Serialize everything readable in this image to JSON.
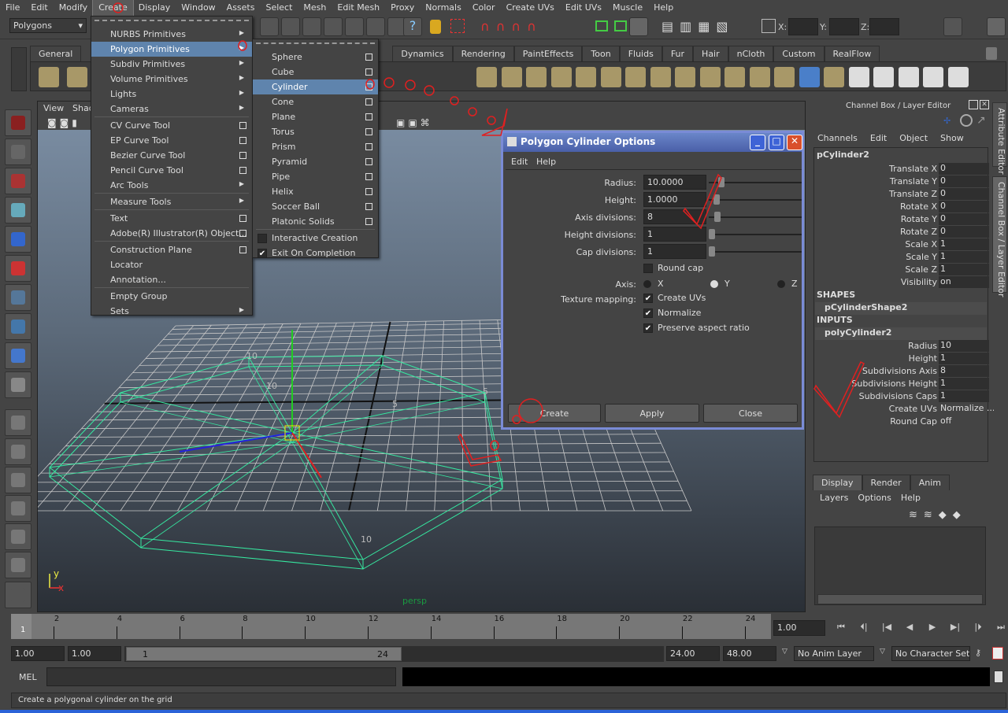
{
  "menubar": [
    "File",
    "Edit",
    "Modify",
    "Create",
    "Display",
    "Window",
    "Assets",
    "Select",
    "Mesh",
    "Edit Mesh",
    "Proxy",
    "Normals",
    "Color",
    "Create UVs",
    "Edit UVs",
    "Muscle",
    "Help"
  ],
  "status_line": {
    "menu_set": "Polygons",
    "x_label": "X:",
    "y_label": "Y:",
    "z_label": "Z:"
  },
  "shelf_tabs": [
    "General",
    "Dynamics",
    "Rendering",
    "PaintEffects",
    "Toon",
    "Fluids",
    "Fur",
    "Hair",
    "nCloth",
    "Custom",
    "RealFlow"
  ],
  "create_menu": [
    {
      "label": "NURBS Primitives",
      "type": "sub"
    },
    {
      "label": "Polygon Primitives",
      "type": "sub",
      "hl": true
    },
    {
      "label": "Subdiv Primitives",
      "type": "sub"
    },
    {
      "label": "Volume Primitives",
      "type": "sub"
    },
    {
      "label": "Lights",
      "type": "sub"
    },
    {
      "label": "Cameras",
      "type": "sub"
    },
    {
      "type": "sep"
    },
    {
      "label": "CV Curve Tool",
      "type": "opt"
    },
    {
      "label": "EP Curve Tool",
      "type": "opt"
    },
    {
      "label": "Bezier Curve Tool",
      "type": "opt"
    },
    {
      "label": "Pencil Curve Tool",
      "type": "opt"
    },
    {
      "label": "Arc Tools",
      "type": "sub"
    },
    {
      "type": "sep"
    },
    {
      "label": "Measure Tools",
      "type": "sub"
    },
    {
      "type": "sep"
    },
    {
      "label": "Text",
      "type": "opt"
    },
    {
      "label": "Adobe(R) Illustrator(R) Object...",
      "type": "opt"
    },
    {
      "type": "sep"
    },
    {
      "label": "Construction Plane",
      "type": "opt"
    },
    {
      "label": "Locator",
      "type": "none"
    },
    {
      "label": "Annotation...",
      "type": "none"
    },
    {
      "type": "sep"
    },
    {
      "label": "Empty Group",
      "type": "none"
    },
    {
      "label": "Sets",
      "type": "sub"
    }
  ],
  "poly_menu": [
    {
      "label": "Sphere",
      "type": "opt"
    },
    {
      "label": "Cube",
      "type": "opt"
    },
    {
      "label": "Cylinder",
      "type": "opt",
      "hl": true
    },
    {
      "label": "Cone",
      "type": "opt"
    },
    {
      "label": "Plane",
      "type": "opt"
    },
    {
      "label": "Torus",
      "type": "opt"
    },
    {
      "label": "Prism",
      "type": "opt"
    },
    {
      "label": "Pyramid",
      "type": "opt"
    },
    {
      "label": "Pipe",
      "type": "opt"
    },
    {
      "label": "Helix",
      "type": "opt"
    },
    {
      "label": "Soccer Ball",
      "type": "opt"
    },
    {
      "label": "Platonic Solids",
      "type": "opt"
    },
    {
      "type": "sep"
    },
    {
      "label": "Interactive Creation",
      "type": "check",
      "checked": false
    },
    {
      "label": "Exit On Completion",
      "type": "check",
      "checked": true
    }
  ],
  "viewport": {
    "menu": [
      "View",
      "Shad"
    ],
    "camera_label": "persp",
    "axis_y": "y",
    "axis_x": "x",
    "grid_labels": [
      "10",
      "5",
      "5",
      "10",
      "10"
    ]
  },
  "dialog": {
    "title": "Polygon Cylinder Options",
    "menu": [
      "Edit",
      "Help"
    ],
    "fields": [
      {
        "label": "Radius:",
        "value": "10.0000",
        "slider": 0.1
      },
      {
        "label": "Height:",
        "value": "1.0000",
        "slider": 0.05
      },
      {
        "label": "Axis divisions:",
        "value": "8",
        "slider": 0.06
      },
      {
        "label": "Height divisions:",
        "value": "1",
        "slider": 0.0
      },
      {
        "label": "Cap divisions:",
        "value": "1",
        "slider": 0.0
      }
    ],
    "round_cap": {
      "label": "Round cap",
      "checked": false
    },
    "axis": {
      "label": "Axis:",
      "options": [
        "X",
        "Y",
        "Z"
      ],
      "selected": "Y"
    },
    "texture": {
      "label": "Texture mapping:",
      "options": [
        {
          "label": "Create UVs",
          "checked": true
        },
        {
          "label": "Normalize",
          "checked": true
        },
        {
          "label": "Preserve aspect ratio",
          "checked": true
        }
      ]
    },
    "buttons": [
      "Create",
      "Apply",
      "Close"
    ]
  },
  "channel_box": {
    "title": "Channel Box / Layer Editor",
    "menu": [
      "Channels",
      "Edit",
      "Object",
      "Show"
    ],
    "object": "pCylinder2",
    "attrs": [
      {
        "n": "Translate X",
        "v": "0"
      },
      {
        "n": "Translate Y",
        "v": "0"
      },
      {
        "n": "Translate Z",
        "v": "0"
      },
      {
        "n": "Rotate X",
        "v": "0"
      },
      {
        "n": "Rotate Y",
        "v": "0"
      },
      {
        "n": "Rotate Z",
        "v": "0"
      },
      {
        "n": "Scale X",
        "v": "1"
      },
      {
        "n": "Scale Y",
        "v": "1"
      },
      {
        "n": "Scale Z",
        "v": "1"
      },
      {
        "n": "Visibility",
        "v": "on"
      }
    ],
    "shapes_header": "SHAPES",
    "shape": "pCylinderShape2",
    "inputs_header": "INPUTS",
    "input": "polyCylinder2",
    "input_attrs": [
      {
        "n": "Radius",
        "v": "10"
      },
      {
        "n": "Height",
        "v": "1"
      },
      {
        "n": "Subdivisions Axis",
        "v": "8"
      },
      {
        "n": "Subdivisions Height",
        "v": "1"
      },
      {
        "n": "Subdivisions Caps",
        "v": "1"
      }
    ],
    "extra": [
      {
        "n": "Create UVs",
        "v": "Normalize ..."
      },
      {
        "n": "Round Cap",
        "v": "off"
      }
    ]
  },
  "side_tabs": [
    "Attribute Editor",
    "Channel Box / Layer Editor"
  ],
  "layer_editor": {
    "tabs": [
      "Display",
      "Render",
      "Anim"
    ],
    "menu": [
      "Layers",
      "Options",
      "Help"
    ]
  },
  "timeline": {
    "ticks": [
      "2",
      "4",
      "6",
      "8",
      "10",
      "12",
      "14",
      "16",
      "18",
      "20",
      "22",
      "24"
    ],
    "current": "1",
    "current_field": "1.00"
  },
  "range": {
    "start": "1.00",
    "play_start": "1.00",
    "range_start": "1",
    "range_end": "24",
    "play_end": "24.00",
    "end": "48.00",
    "anim_layer": "No Anim Layer",
    "character_set": "No Character Set"
  },
  "command_line": {
    "label": "MEL"
  },
  "help_line": "Create a polygonal cylinder on the grid",
  "colors": {
    "menu_highlight": "#5f84ad",
    "wireframe": "#36e8a0",
    "dialog_border": "#7a8bd6",
    "annotation": "#e02020"
  }
}
